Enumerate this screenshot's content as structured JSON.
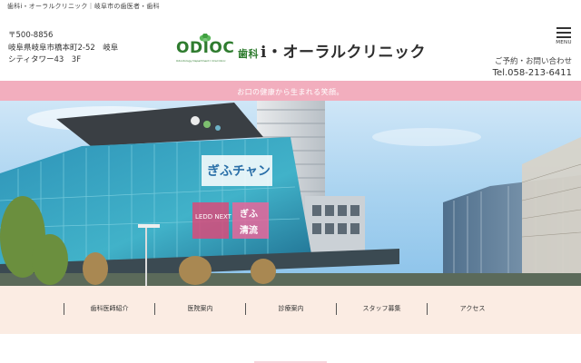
{
  "topbar": {
    "text": "歯科i・オーラルクリニック｜岐阜市の歯医者・歯科"
  },
  "header": {
    "postal": "〒500-8856",
    "address_line1": "岐阜県岐阜市橋本町2-52　岐阜",
    "address_line2": "シティタワー43　3F",
    "logo_mark": "ODIOC",
    "logo_tagline": "Odontology Department I Oral Clinic",
    "logo_prefix": "歯科",
    "logo_name": "i・オーラルクリニック",
    "menu_label": "MENU",
    "contact_label": "ご予約・お問い合わせ",
    "tel": "Tel.058-213-6411"
  },
  "banner": {
    "text": "お口の健康から生まれる笑顔。"
  },
  "hero": {
    "sign_1": "ぎふチャン",
    "sign_2": "LEDD NEXT",
    "sign_3": "ぎふ",
    "sign_4": "清流"
  },
  "nav": {
    "items": [
      {
        "label": "歯科医師紹介"
      },
      {
        "label": "医院案内"
      },
      {
        "label": "診療案内"
      },
      {
        "label": "スタッフ募集"
      },
      {
        "label": "アクセス"
      }
    ]
  },
  "colors": {
    "accent_pink": "#f2aebe",
    "nav_bg": "#fbece3",
    "logo_green": "#2f7c2f"
  }
}
